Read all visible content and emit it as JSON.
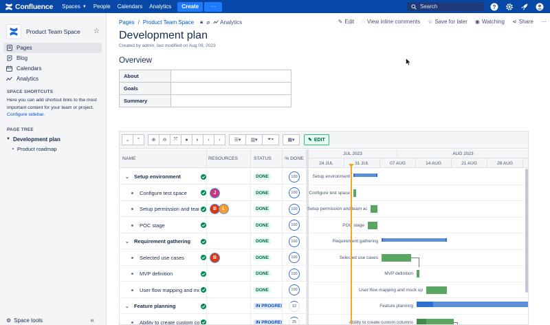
{
  "nav": {
    "product": "Confluence",
    "items": [
      {
        "label": "Spaces",
        "dropdown": true
      },
      {
        "label": "People",
        "dropdown": false
      },
      {
        "label": "Calendars",
        "dropdown": false
      },
      {
        "label": "Analytics",
        "dropdown": false
      }
    ],
    "create_label": "Create",
    "more_label": "···",
    "search_placeholder": "Search",
    "colors": {
      "bar": "#0747a6",
      "accent": "#1d7afc"
    }
  },
  "sidebar": {
    "space_name": "Product Team Space",
    "items": [
      {
        "label": "Pages",
        "icon": "pages-icon",
        "active": true
      },
      {
        "label": "Blog",
        "icon": "blog-icon",
        "active": false
      },
      {
        "label": "Calendars",
        "icon": "calendar-icon",
        "active": false
      },
      {
        "label": "Analytics",
        "icon": "analytics-icon",
        "active": false
      }
    ],
    "shortcuts_heading": "SPACE SHORTCUTS",
    "shortcuts_text": "Here you can add shortcut links to the most important content for your team or project.",
    "configure_link": "Configure sidebar.",
    "tree_heading": "PAGE TREE",
    "tree_parent": "Development plan",
    "tree_child": "Product roadmap",
    "footer": "Space tools",
    "collapse": "«"
  },
  "page": {
    "breadcrumb": [
      "Pages",
      "Product Team Space"
    ],
    "analytics_label": "Analytics",
    "actions": [
      "Edit",
      "View inline comments",
      "Save for later",
      "Watching",
      "Share",
      "···"
    ],
    "title": "Development plan",
    "byline": "Created by admin, last modified on Aug 09, 2023",
    "overview_heading": "Overview",
    "overview_rows": [
      "About",
      "Goals",
      "Summary"
    ]
  },
  "gantt": {
    "edit_label": "EDIT",
    "columns": {
      "name": "NAME",
      "resources": "RESOURCES",
      "status": "STATUS",
      "done": "% DONE"
    },
    "months": [
      "JUL 2023",
      "AUG 2023"
    ],
    "weeks": [
      "24 JUL",
      "31 JUL",
      "07 AUG",
      "14 AUG",
      "21 AUG",
      "28 AUG"
    ],
    "rows": [
      {
        "name": "Setup environment",
        "level": 0,
        "status": "DONE",
        "pct": "100",
        "avatars": []
      },
      {
        "name": "Configure test space",
        "level": 1,
        "status": "DONE",
        "pct": "100",
        "avatars": [
          {
            "letter": "J",
            "color": "#c9377a"
          }
        ]
      },
      {
        "name": "Setup permission and team access",
        "level": 1,
        "status": "DONE",
        "pct": "100",
        "avatars": [
          {
            "letter": "B",
            "color": "#de350b"
          },
          {
            "letter": "L",
            "color": "#ff991f"
          }
        ]
      },
      {
        "name": "POC stage",
        "level": 1,
        "status": "DONE",
        "pct": "100",
        "avatars": []
      },
      {
        "name": "Requirement gathering",
        "level": 0,
        "status": "DONE",
        "pct": "100",
        "avatars": []
      },
      {
        "name": "Selected use cases",
        "level": 1,
        "status": "DONE",
        "pct": "100",
        "avatars": [
          {
            "letter": "B",
            "color": "#de350b"
          }
        ]
      },
      {
        "name": "MVP definition",
        "level": 1,
        "status": "DONE",
        "pct": "100",
        "avatars": []
      },
      {
        "name": "User flow mapping and mock up",
        "level": 1,
        "status": "DONE",
        "pct": "100",
        "avatars": []
      },
      {
        "name": "Feature planning",
        "level": 0,
        "status": "IN PROGRESS",
        "pct": "12",
        "avatars": []
      },
      {
        "name": "Ability to create custom columns",
        "level": 1,
        "status": "IN PROGRESS",
        "pct": "25",
        "avatars": []
      }
    ]
  }
}
